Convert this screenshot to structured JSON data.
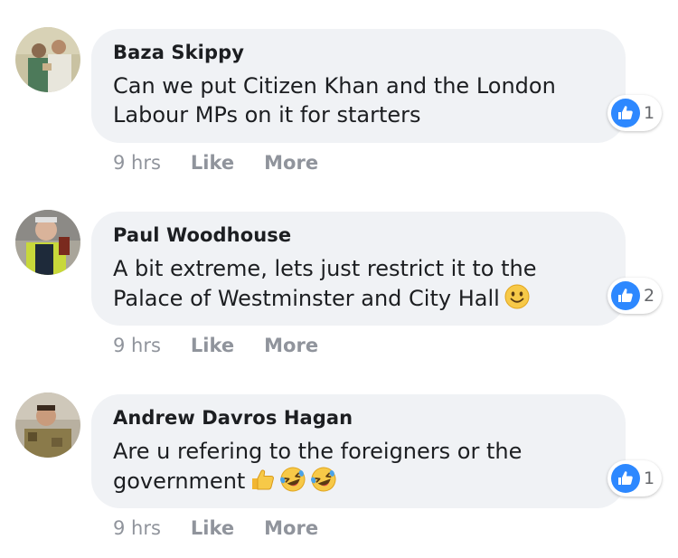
{
  "colors": {
    "bubble_bg": "#f0f2f5",
    "like_blue": "#2d88ff",
    "meta_text": "#90949c"
  },
  "comments": [
    {
      "author": "Baza Skippy",
      "text": "Can we put Citizen Khan and the London\nLabour MPs on it for starters",
      "emojis": [],
      "reaction_icon": "like-thumb-icon",
      "reaction_count": "1",
      "time": "9 hrs",
      "like_label": "Like",
      "more_label": "More"
    },
    {
      "author": "Paul Woodhouse",
      "text": "A bit extreme, lets just restrict it to the\nPalace of Westminster and City Hall",
      "emojis": [
        "smile-emoji"
      ],
      "reaction_icon": "like-thumb-icon",
      "reaction_count": "2",
      "time": "9 hrs",
      "like_label": "Like",
      "more_label": "More"
    },
    {
      "author": "Andrew Davros Hagan",
      "text": "Are u refering to the foreigners or the\ngovernment",
      "emojis": [
        "thumbs-up-emoji",
        "rolling-laughing-emoji",
        "rolling-laughing-emoji"
      ],
      "reaction_icon": "like-thumb-icon",
      "reaction_count": "1",
      "time": "9 hrs",
      "like_label": "Like",
      "more_label": "More"
    }
  ]
}
